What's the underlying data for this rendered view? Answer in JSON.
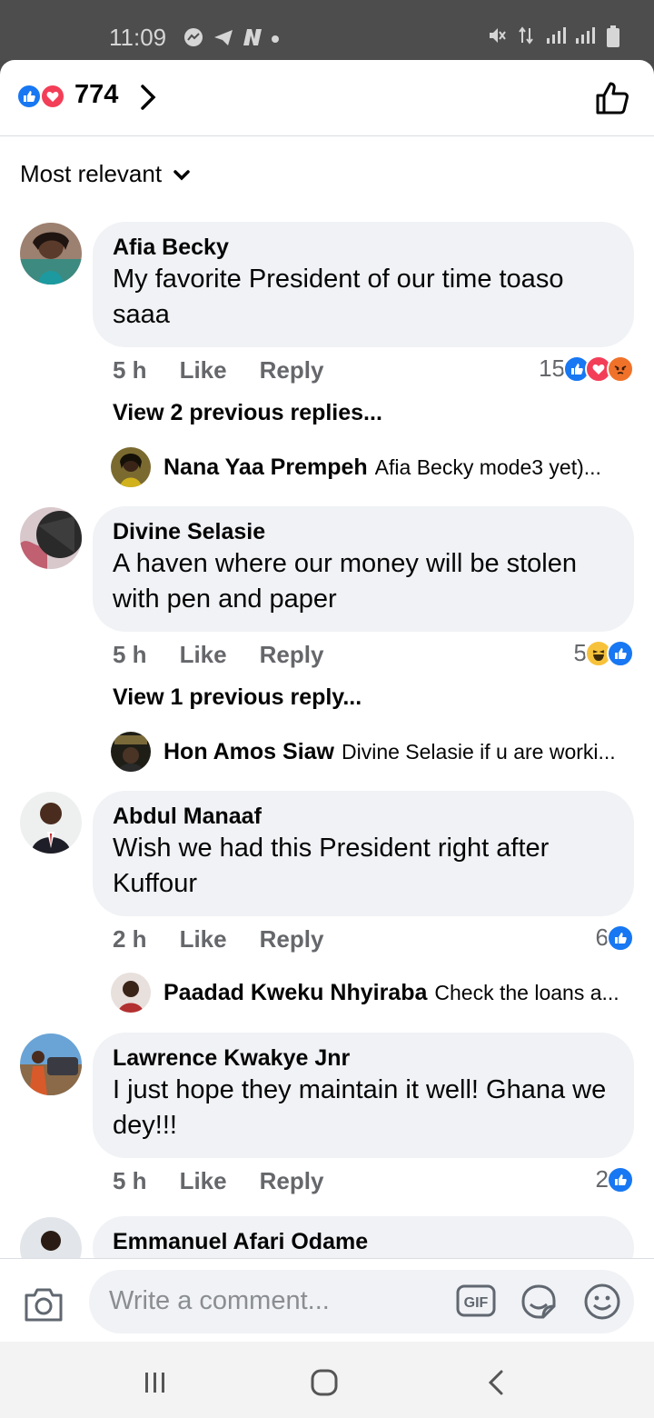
{
  "status_bar": {
    "time": "11:09"
  },
  "header": {
    "reaction_count": "774"
  },
  "sort": {
    "label": "Most relevant"
  },
  "comments": [
    {
      "author": "Afia Becky",
      "text": "My favorite President of our time toaso saaa",
      "age": "5 h",
      "like": "Like",
      "reply": "Reply",
      "reaction_count": "15",
      "reactions": [
        "like",
        "love",
        "angry"
      ],
      "view_previous": "View 2 previous replies...",
      "latest_reply": {
        "author": "Nana Yaa Prempeh",
        "text": "Afia Becky mode3 yet)..."
      }
    },
    {
      "author": "Divine Selasie",
      "text": "A haven where our money will be stolen with pen and paper",
      "age": "5 h",
      "like": "Like",
      "reply": "Reply",
      "reaction_count": "5",
      "reactions": [
        "haha",
        "like"
      ],
      "view_previous": "View 1 previous reply...",
      "latest_reply": {
        "author": "Hon Amos Siaw",
        "text": "Divine Selasie if u are worki..."
      }
    },
    {
      "author": "Abdul Manaaf",
      "text": "Wish we had this President right after Kuffour",
      "age": "2 h",
      "like": "Like",
      "reply": "Reply",
      "reaction_count": "6",
      "reactions": [
        "like"
      ],
      "latest_reply": {
        "author": "Paadad Kweku Nhyiraba",
        "text": "Check the loans a..."
      }
    },
    {
      "author": "Lawrence Kwakye Jnr",
      "text": "I just hope they maintain it well! Ghana we dey!!!",
      "age": "5 h",
      "like": "Like",
      "reply": "Reply",
      "reaction_count": "2",
      "reactions": [
        "like"
      ]
    },
    {
      "author": "Emmanuel Afari Odame"
    }
  ],
  "composer": {
    "placeholder": "Write a comment..."
  },
  "colors": {
    "like_blue": "#1877f2",
    "love_red": "#f33e58",
    "bubble_grey": "#f0f2f5",
    "meta_grey": "#65676b"
  }
}
